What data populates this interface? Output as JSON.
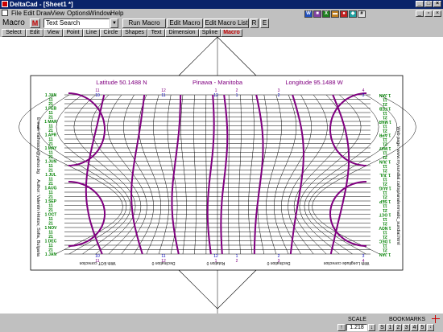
{
  "window": {
    "title": "DeltaCad - [Sheet1 *]",
    "min": "_",
    "max": "□",
    "close": "×"
  },
  "menu": [
    "File",
    "Edit",
    "Draw",
    "View",
    "Options",
    "Window",
    "Help"
  ],
  "macro": {
    "label": "Macro",
    "field_value": "Text Search",
    "run": "Run Macro",
    "edit": "Edit Macro",
    "edit_list": "Edit Macro List",
    "r": "R",
    "e": "E"
  },
  "tabs": [
    "Select",
    "Edit",
    "View",
    "Point",
    "Line",
    "Circle",
    "Shapes",
    "Text",
    "Dimension",
    "Spline",
    "Macro"
  ],
  "drawing": {
    "lat": "Latitude 50.1488 N",
    "place": "Pinawa - Manitoba",
    "lon": "Longitude 95.1488 W",
    "top_nums_1": [
      "11",
      "12",
      "1",
      "2",
      "3",
      "4"
    ],
    "top_nums_2": [
      "10",
      "11",
      "12",
      "1",
      "2",
      "3"
    ],
    "bottom_nums_1": [
      "11",
      "12",
      "1",
      "2",
      "3",
      "4"
    ],
    "bottom_nums_2": [
      "10",
      "11",
      "12",
      "1",
      "2",
      "3"
    ],
    "left_dates": [
      "1 JAN",
      "11",
      "21",
      "1 FEB",
      "11",
      "21",
      "1 MAR",
      "11",
      "21",
      "1 APR",
      "11",
      "21",
      "1 MAY",
      "11",
      "21",
      "1 JUN",
      "11",
      "21",
      "1 JUL",
      "11",
      "21",
      "1 AUG",
      "11",
      "21",
      "1 SEP",
      "11",
      "21",
      "1 OCT",
      "11",
      "21",
      "1 NOV",
      "11",
      "21",
      "1 DEC",
      "11",
      "21",
      "1 JAN"
    ],
    "right_dates": [
      "1 JAN",
      "11",
      "21",
      "1 FEB",
      "11",
      "21",
      "1 MAR",
      "11",
      "21",
      "1 APR",
      "11",
      "21",
      "1 MAY",
      "11",
      "21",
      "1 JUN",
      "11",
      "21",
      "1 JUL",
      "11",
      "21",
      "1 AUG",
      "11",
      "21",
      "1 SEP",
      "11",
      "21",
      "1 OCT",
      "11",
      "21",
      "1 NOV",
      "11",
      "21",
      "1 DEC",
      "11",
      "21",
      "1 JAN"
    ],
    "left_side_text_1": "E-mail: valhristov@yahoo.bg",
    "left_side_text_2": "Author: Valentin Hristov, Sofia, Bulgaria",
    "right_side_text": "Web page: www.mysundial.ca/tsp/analemmatic_sundial.html",
    "bottom_labels": [
      "With EOT correction",
      "Declination 0",
      "Rotation 0",
      "Declination 0",
      "With Longitude correction"
    ]
  },
  "status": {
    "scale_label": "SCALE",
    "scale_value": "1.218",
    "bookmarks_label": "BOOKMARKS",
    "bookmarks": [
      "S",
      "1",
      "2",
      "3",
      "4",
      "5"
    ],
    "arrow_up": "↑",
    "arrow_down": "↓"
  },
  "colors": {
    "titlebar": "#0a246a",
    "curve": "#800080",
    "month": "#008000",
    "accent": "#c00000"
  }
}
